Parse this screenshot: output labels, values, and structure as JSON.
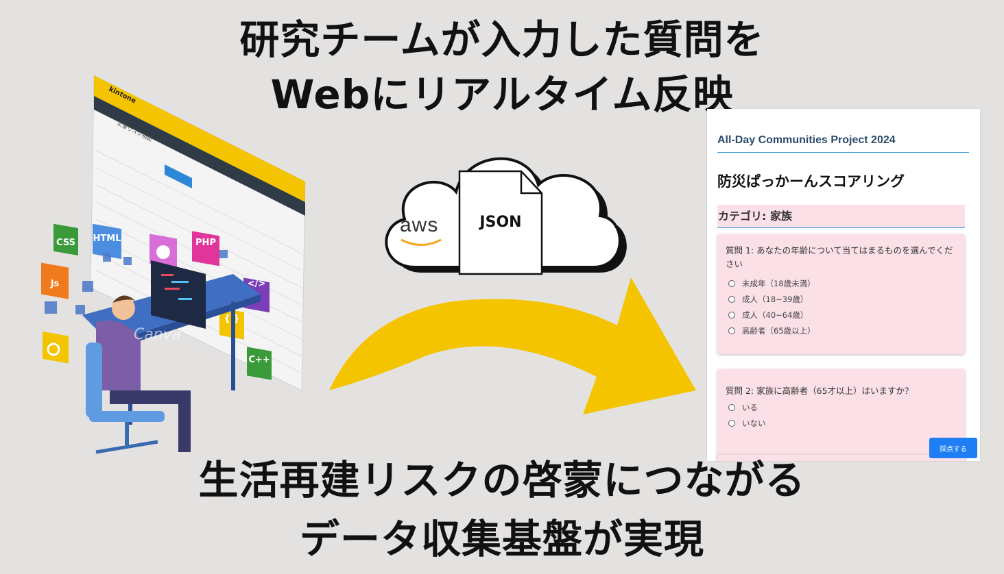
{
  "headline_top": "研究チームが入力した質問を\nWebにリアルタイム反映",
  "headline_bottom": "生活再建リスクの啓蒙につながる\nデータ収集基盤が実現",
  "illustration": {
    "app_name": "kintone",
    "app_title": "災害リスク相談",
    "watermark": "Canva",
    "tech_tiles": [
      "CSS",
      "HTML",
      "PHP",
      "Js",
      "</>",
      "{ }",
      "C++"
    ],
    "tech_icons": [
      "gear-icon",
      "search-icon"
    ]
  },
  "cloud": {
    "aws_label": "aws",
    "file_label": "JSON"
  },
  "web": {
    "header": "All-Day Communities Project 2024",
    "title": "防災ぱっかーんスコアリング",
    "category": "カテゴリ: 家族",
    "questions": [
      {
        "text": "質問 1: あなたの年齢について当てはまるものを選んでください",
        "options": [
          "未成年（18歳未満）",
          "成人（18~39歳）",
          "成人（40~64歳）",
          "高齢者（65歳以上）"
        ]
      },
      {
        "text": "質問 2: 家族に高齢者（65才以上）はいますか？",
        "options": [
          "いる",
          "いない"
        ]
      }
    ],
    "submit_label": "採点する"
  },
  "colors": {
    "background": "#e3e2e1",
    "arrow": "#f5c400",
    "kintone_yellow": "#f5c400",
    "form_pink": "#fbe1e7",
    "accent_blue": "#3a98d9",
    "button_blue": "#1e7ff5"
  }
}
